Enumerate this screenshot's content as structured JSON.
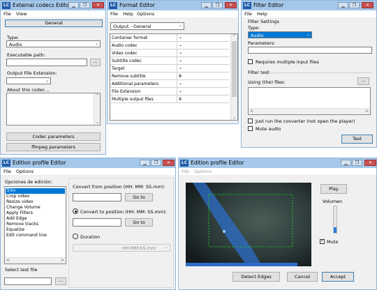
{
  "common": {
    "logo": "LC",
    "minimize": "▁",
    "maximize": "❐",
    "close": "✕",
    "dropdown": "⌄",
    "scroll_up": "⌃",
    "scroll_down": "⌄",
    "scroll_left": "<",
    "scroll_right": ">",
    "browse": "..."
  },
  "ext": {
    "title": "External codecs Editor",
    "menu": [
      "File",
      "View"
    ],
    "general_button": "General",
    "type_label": "Type:",
    "type_value": "Audio",
    "exe_label": "Executable path:",
    "ext_label": "Output File Extension:",
    "about_label": "About this codec...",
    "codec_params_button": "Codec parameters",
    "ffmpeg_params_button": "ffmpeg parameters"
  },
  "fmt": {
    "title": "Format Editor",
    "menu": [
      "File",
      "Help",
      "Options"
    ],
    "profile": "Output - General",
    "rows": [
      {
        "name": "Container format",
        "value": ""
      },
      {
        "name": "Audio codec",
        "value": ""
      },
      {
        "name": "Video codec",
        "value": ""
      },
      {
        "name": "Subtitle codec",
        "value": ""
      },
      {
        "name": "Target",
        "value": ""
      },
      {
        "name": "Remove subtitle",
        "value": "0"
      },
      {
        "name": "Additional parameters",
        "value": ""
      },
      {
        "name": "File Extension",
        "value": ""
      },
      {
        "name": "Multiple output files",
        "value": "0"
      }
    ]
  },
  "flt": {
    "title": "Filter Editor",
    "menu": [
      "File",
      "Help"
    ],
    "settings_group": "Filter Settings",
    "type_label": "Type:",
    "type_value": "Audio",
    "params_label": "Parameters:",
    "requires_multiple": "Requires multiple input files",
    "test_group": "Filter test",
    "using_files": "Using (the) files:",
    "just_run": "Just run the converter (not open the player)",
    "mute_audio": "Mute audio",
    "test_button": "Test"
  },
  "edp1": {
    "title": "Edition profile Editor",
    "menu": [
      "File",
      "Options"
    ],
    "options_label": "Opciones de edición:",
    "options": [
      "Trim",
      "Crop video",
      "Resize video",
      "Change Volume",
      "Apply Filters",
      "Add Edge",
      "Remove tracks",
      "Equalize",
      "Edit command line"
    ],
    "selected_index": 0,
    "convert_from_label": "Convert from position (HH: MM: SS.mm):",
    "go_to": "Go to",
    "convert_to_label": "Convert to position (HH: MM: SS.mm):",
    "duration_label": "Duration",
    "duration_placeholder": "HH:MM:SS.mm",
    "select_test_file": "Select test file"
  },
  "edp2": {
    "title": "Edition profile Editor",
    "menu": [
      "File",
      "Options"
    ],
    "play_button": "Play",
    "volume_label": "Volumen",
    "volume_level": 0.2,
    "mute_label": "Mute",
    "mute_checked": true,
    "detect_edges_button": "Detect Edges",
    "cancel_button": "Cancel",
    "accept_button": "Accept"
  },
  "colors": {
    "titlebar": "#a5c8ea",
    "close": "#c75050",
    "selection": "#0078d7",
    "video_dark": "#1d2a2c",
    "video_highlight": "#2e6ec8",
    "crop_box": "#22c622"
  }
}
